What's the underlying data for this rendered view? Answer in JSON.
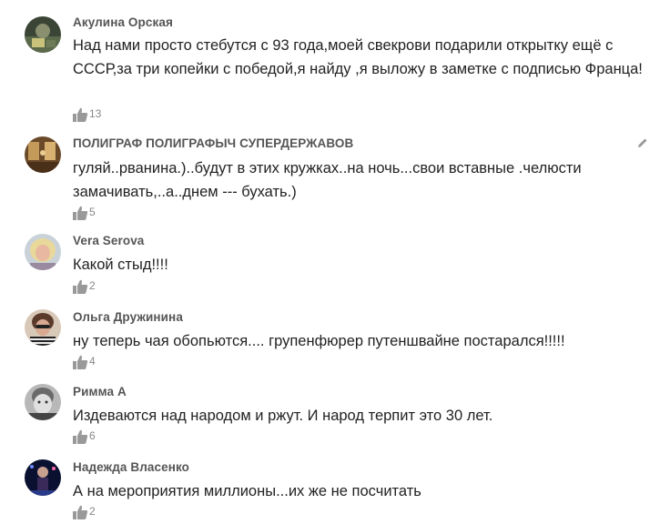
{
  "comments": [
    {
      "author": "Акулина Орская",
      "text": "Над нами просто стебутся с 93 года,моей свекрови подарили открытку ещё с СССР,за три копейки с победой,я найду ,я выложу в заметке с подписью Франца!",
      "likes": "13",
      "avatar": "avatar-dark-green"
    },
    {
      "author": "ПОЛИГРАФ ПОЛИГРАФЫЧ СУПЕРДЕРЖАВОВ",
      "text": "гуляй..рванина.)..будут в этих кружках..на ночь...свои вставные .челюсти замачивать,..а..днем --- бухать.)",
      "likes": "5",
      "avatar": "avatar-sepia-interior",
      "edit_icon": "pencil-icon"
    },
    {
      "author": "Vera Serova",
      "text": "Какой стыд!!!!",
      "likes": "2",
      "avatar": "avatar-blonde-woman"
    },
    {
      "author": "Ольга Дружинина",
      "text": "ну теперь чая обопьются.... групенфюрер путеншвайне постарался!!!!!",
      "likes": "4",
      "avatar": "avatar-woman-sunglasses"
    },
    {
      "author": "Римма А",
      "text": "Издеваются над народом и ржут. И народ терпит это 30 лет.",
      "likes": "6",
      "avatar": "avatar-bw-child"
    },
    {
      "author": "Надежда Власенко",
      "text": "А на мероприятия миллионы...их же не посчитать",
      "likes": "2",
      "avatar": "avatar-dark-stage"
    }
  ],
  "colors": {
    "author": "#555555",
    "text": "#222222",
    "meta": "#888888"
  }
}
